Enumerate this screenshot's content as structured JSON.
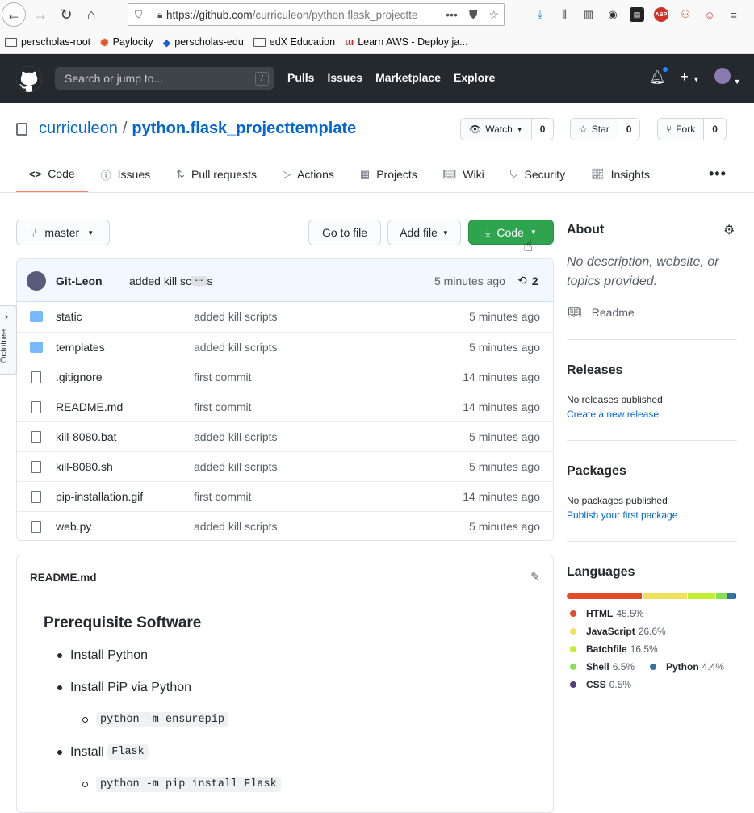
{
  "browser": {
    "url_host": "https://github.com",
    "url_path": "/curriculeon/python.flask_projectte",
    "bookmarks": [
      "perscholas-root",
      "Paylocity",
      "perscholas-edu",
      "edX Education",
      "Learn AWS - Deploy ja..."
    ]
  },
  "github_header": {
    "search_placeholder": "Search or jump to...",
    "slash_key": "/",
    "nav": [
      "Pulls",
      "Issues",
      "Marketplace",
      "Explore"
    ],
    "plus": "+"
  },
  "repo": {
    "owner": "curriculeon",
    "separator": "/",
    "name": "python.flask_projecttemplate",
    "watch": {
      "label": "Watch",
      "count": "0"
    },
    "star": {
      "label": "Star",
      "count": "0"
    },
    "fork": {
      "label": "Fork",
      "count": "0"
    }
  },
  "tabs": [
    "Code",
    "Issues",
    "Pull requests",
    "Actions",
    "Projects",
    "Wiki",
    "Security",
    "Insights"
  ],
  "tab_icons": [
    "code-icon",
    "issue-icon",
    "pull-request-icon",
    "play-icon",
    "project-icon",
    "book-icon",
    "shield-icon",
    "graph-icon"
  ],
  "branch": {
    "name": "master"
  },
  "buttons": {
    "go_to_file": "Go to file",
    "add_file": "Add file",
    "code": "Code"
  },
  "commit": {
    "author": "Git-Leon",
    "message": "added kill scripts",
    "ellipsis": "…",
    "time": "5 minutes ago",
    "commits_count": "2"
  },
  "files": [
    {
      "name": "static",
      "type": "dir",
      "message": "added kill scripts",
      "time": "5 minutes ago"
    },
    {
      "name": "templates",
      "type": "dir",
      "message": "added kill scripts",
      "time": "5 minutes ago"
    },
    {
      "name": ".gitignore",
      "type": "file",
      "message": "first commit",
      "time": "14 minutes ago"
    },
    {
      "name": "README.md",
      "type": "file",
      "message": "first commit",
      "time": "14 minutes ago"
    },
    {
      "name": "kill-8080.bat",
      "type": "file",
      "message": "added kill scripts",
      "time": "5 minutes ago"
    },
    {
      "name": "kill-8080.sh",
      "type": "file",
      "message": "added kill scripts",
      "time": "5 minutes ago"
    },
    {
      "name": "pip-installation.gif",
      "type": "file",
      "message": "first commit",
      "time": "14 minutes ago"
    },
    {
      "name": "web.py",
      "type": "file",
      "message": "added kill scripts",
      "time": "5 minutes ago"
    }
  ],
  "readme": {
    "filename": "README.md",
    "heading": "Prerequisite Software",
    "items": {
      "install_python": "Install Python",
      "install_pip": "Install PiP via Python",
      "pip_cmd": "python -m ensurepip",
      "install_prefix": "Install",
      "flask": "Flask",
      "flask_cmd": "python -m pip install Flask"
    }
  },
  "about": {
    "title": "About",
    "description": "No description, website, or topics provided.",
    "readme": "Readme"
  },
  "releases": {
    "title": "Releases",
    "status": "No releases published",
    "link": "Create a new release"
  },
  "packages": {
    "title": "Packages",
    "status": "No packages published",
    "link": "Publish your first package"
  },
  "languages": {
    "title": "Languages",
    "items": [
      {
        "name": "HTML",
        "pct": "45.5%",
        "value": 45.5,
        "color": "#e34c26"
      },
      {
        "name": "JavaScript",
        "pct": "26.6%",
        "value": 26.6,
        "color": "#f1e05a"
      },
      {
        "name": "Batchfile",
        "pct": "16.5%",
        "value": 16.5,
        "color": "#c1f12e"
      },
      {
        "name": "Shell",
        "pct": "6.5%",
        "value": 6.5,
        "color": "#89e051"
      },
      {
        "name": "Python",
        "pct": "4.4%",
        "value": 4.4,
        "color": "#3572a5"
      },
      {
        "name": "CSS",
        "pct": "0.5%",
        "value": 0.5,
        "color": "#563d7c"
      }
    ]
  },
  "octotree": {
    "label": "Octotree"
  }
}
